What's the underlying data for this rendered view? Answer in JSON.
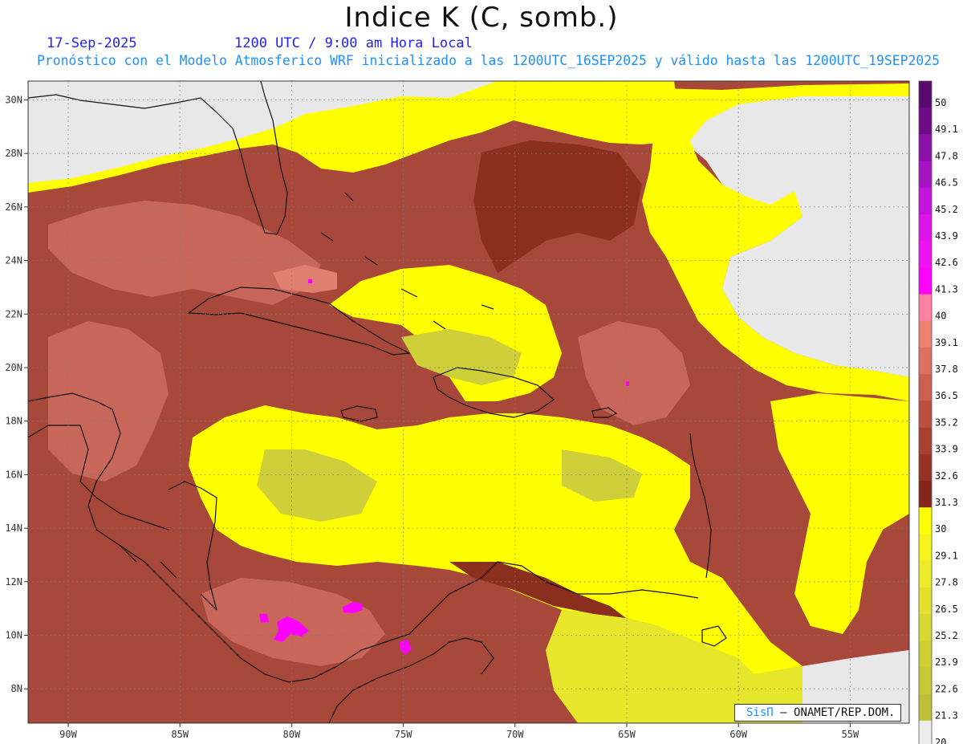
{
  "header": {
    "title": "Indice K (C, somb.)",
    "date": "17-Sep-2025",
    "time": "1200 UTC / 9:00 am Hora Local",
    "description": "Pronóstico con el Modelo Atmosferico WRF inicializado a las 1200UTC_16SEP2025 y válido hasta las  1200UTC_19SEP2025"
  },
  "map": {
    "lon_labels": [
      "90W",
      "85W",
      "80W",
      "75W",
      "70W",
      "65W",
      "60W",
      "55W"
    ],
    "lat_labels": [
      "30N",
      "28N",
      "26N",
      "24N",
      "22N",
      "20N",
      "18N",
      "16N",
      "14N",
      "12N",
      "10N",
      "8N"
    ],
    "colors": {
      "below_20": "#e8e8e8",
      "yellow_high": "#ffff00",
      "yellow_mid": "#e6e62a",
      "yellow_low": "#cfcf3a",
      "brown_dark": "#8b2e1e",
      "brown_mid": "#a8483a",
      "brown_light": "#c9665a",
      "salmon": "#e08070",
      "magenta": "#ff00ff",
      "coast": "#111111"
    }
  },
  "colorbar": {
    "labels": [
      "50",
      "49.1",
      "47.8",
      "46.5",
      "45.2",
      "43.9",
      "42.6",
      "41.3",
      "40",
      "39.1",
      "37.8",
      "36.5",
      "35.2",
      "33.9",
      "32.6",
      "31.3",
      "30",
      "29.1",
      "27.8",
      "26.5",
      "25.2",
      "23.9",
      "22.6",
      "21.3",
      "20"
    ],
    "colors": [
      "#5a0a6e",
      "#6e0c88",
      "#8a10a8",
      "#a612c4",
      "#c414dc",
      "#dc14ea",
      "#ee12f4",
      "#ff00ff",
      "#ff80a0",
      "#ee8070",
      "#dd7060",
      "#cc6050",
      "#bb5040",
      "#a84030",
      "#963222",
      "#84261a",
      "#ffff00",
      "#f4f41a",
      "#ecec28",
      "#e2e22e",
      "#d8d832",
      "#d0d034",
      "#c8c836",
      "#c0c038",
      "#ececec"
    ]
  },
  "credit": {
    "brand": "SisΠ",
    "text": "– ONAMET/REP.DOM."
  }
}
